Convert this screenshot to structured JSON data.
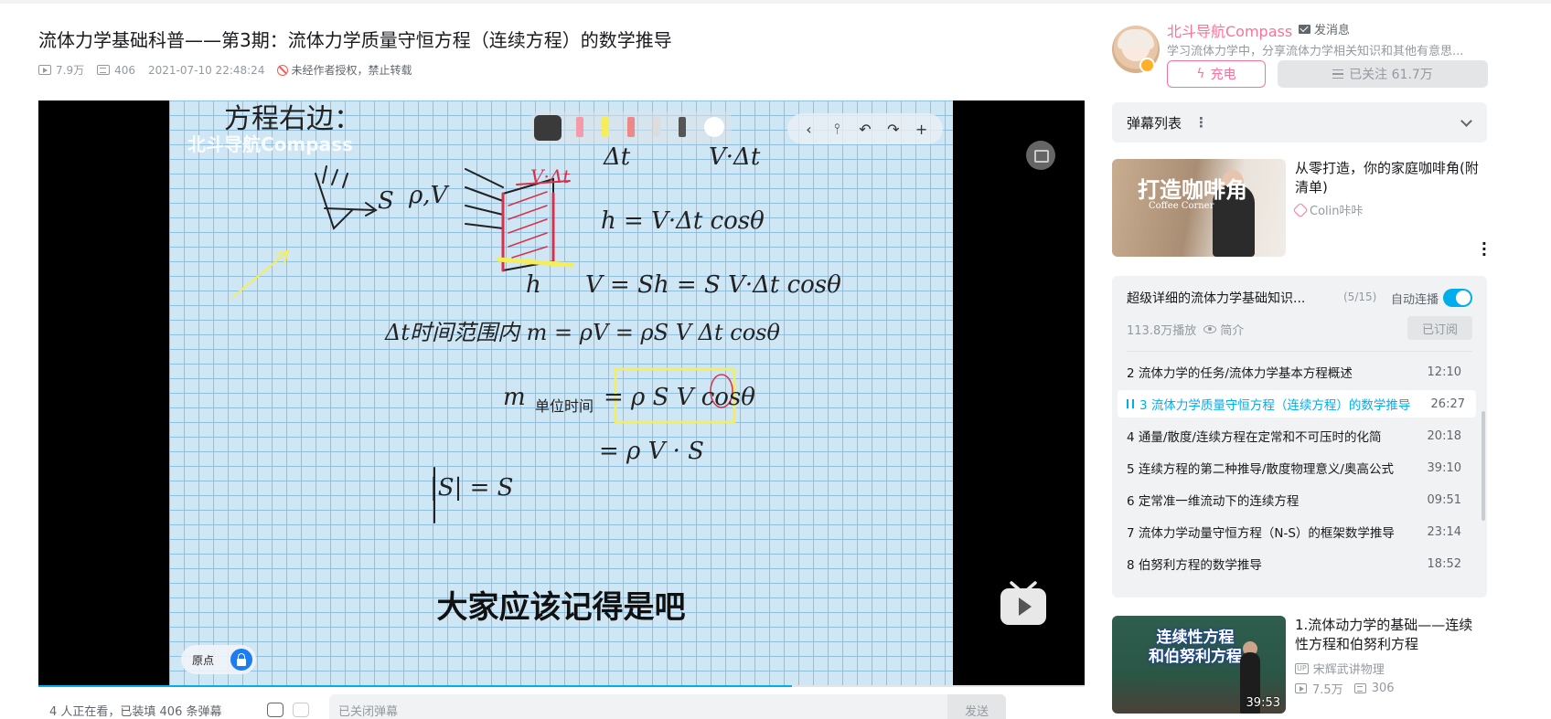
{
  "video": {
    "title": "流体力学基础科普——第3期：流体力学质量守恒方程（连续方程）的数学推导",
    "views": "7.9万",
    "danmaku_count": "406",
    "datetime": "2021-07-10 22:48:24",
    "copyright_notice": "未经作者授权，禁止转载"
  },
  "player": {
    "watermark": "北斗导航Compass",
    "subtitle": "大家应该记得是吧",
    "origin_label": "原点",
    "progress_fraction": 0.72,
    "toolbar_icons": [
      "chevron-left-icon",
      "pin-icon",
      "undo-icon",
      "redo-icon",
      "plus-icon"
    ]
  },
  "danmaku_bar": {
    "viewers": "4 人正在看，已装填 406 条弹幕",
    "placeholder": "已关闭弹幕",
    "send_label": "发送"
  },
  "uploader": {
    "name": "北斗导航Compass",
    "message_label": "发消息",
    "description": "学习流体力学中，分享流体力学相关知识和其他有意思...",
    "charge_label": "充电",
    "follow_label": "已关注 61.7万"
  },
  "danmaku_list": {
    "label": "弹幕列表"
  },
  "ad_card": {
    "thumb_text": "打造咖啡角",
    "thumb_subtext": "Coffee Corner",
    "title": "从零打造，你的家庭咖啡角(附清单)",
    "author": "Colin咔咔"
  },
  "playlist": {
    "title": "超级详细的流体力学基础知识...",
    "count": "(5/15)",
    "autoplay_label": "自动连播",
    "plays": "113.8万播放",
    "intro_label": "简介",
    "subscribed_label": "已订阅",
    "episodes": [
      {
        "title": "2 流体力学的任务/流体力学基本方程概述",
        "duration": "12:10"
      },
      {
        "title": "3 流体力学质量守恒方程（连续方程）的数学推导",
        "duration": "26:27"
      },
      {
        "title": "4 通量/散度/连续方程在定常和不可压时的化简",
        "duration": "20:18"
      },
      {
        "title": "5 连续方程的第二种推导/散度物理意义/奥高公式",
        "duration": "39:10"
      },
      {
        "title": "6 定常准一维流动下的连续方程",
        "duration": "09:51"
      },
      {
        "title": "7 流体力学动量守恒方程（N-S）的框架数学推导",
        "duration": "23:14"
      },
      {
        "title": "8 伯努利方程的数学推导",
        "duration": "18:52"
      }
    ]
  },
  "recommend": {
    "thumb_text_line1": "连续性方程",
    "thumb_text_line2": "和伯努利方程",
    "duration": "39:53",
    "title": "1.流体动力学的基础——连续性方程和伯努利方程",
    "uploader": "宋辉武讲物理",
    "up_tag": "UP",
    "views": "7.5万",
    "danmaku": "306"
  },
  "colors": {
    "accent": "#00aeec",
    "brand_pink": "#fb7299",
    "text": "#18191c",
    "muted": "#9499a0"
  }
}
